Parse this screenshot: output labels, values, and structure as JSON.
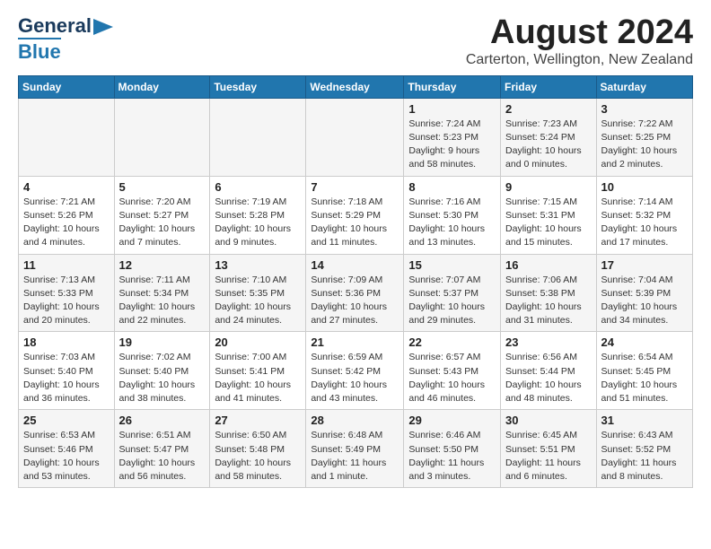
{
  "header": {
    "logo_line1": "General",
    "logo_line2": "Blue",
    "title": "August 2024",
    "subtitle": "Carterton, Wellington, New Zealand"
  },
  "calendar": {
    "days_of_week": [
      "Sunday",
      "Monday",
      "Tuesday",
      "Wednesday",
      "Thursday",
      "Friday",
      "Saturday"
    ],
    "weeks": [
      [
        {
          "day": "",
          "info": ""
        },
        {
          "day": "",
          "info": ""
        },
        {
          "day": "",
          "info": ""
        },
        {
          "day": "",
          "info": ""
        },
        {
          "day": "1",
          "info": "Sunrise: 7:24 AM\nSunset: 5:23 PM\nDaylight: 9 hours\nand 58 minutes."
        },
        {
          "day": "2",
          "info": "Sunrise: 7:23 AM\nSunset: 5:24 PM\nDaylight: 10 hours\nand 0 minutes."
        },
        {
          "day": "3",
          "info": "Sunrise: 7:22 AM\nSunset: 5:25 PM\nDaylight: 10 hours\nand 2 minutes."
        }
      ],
      [
        {
          "day": "4",
          "info": "Sunrise: 7:21 AM\nSunset: 5:26 PM\nDaylight: 10 hours\nand 4 minutes."
        },
        {
          "day": "5",
          "info": "Sunrise: 7:20 AM\nSunset: 5:27 PM\nDaylight: 10 hours\nand 7 minutes."
        },
        {
          "day": "6",
          "info": "Sunrise: 7:19 AM\nSunset: 5:28 PM\nDaylight: 10 hours\nand 9 minutes."
        },
        {
          "day": "7",
          "info": "Sunrise: 7:18 AM\nSunset: 5:29 PM\nDaylight: 10 hours\nand 11 minutes."
        },
        {
          "day": "8",
          "info": "Sunrise: 7:16 AM\nSunset: 5:30 PM\nDaylight: 10 hours\nand 13 minutes."
        },
        {
          "day": "9",
          "info": "Sunrise: 7:15 AM\nSunset: 5:31 PM\nDaylight: 10 hours\nand 15 minutes."
        },
        {
          "day": "10",
          "info": "Sunrise: 7:14 AM\nSunset: 5:32 PM\nDaylight: 10 hours\nand 17 minutes."
        }
      ],
      [
        {
          "day": "11",
          "info": "Sunrise: 7:13 AM\nSunset: 5:33 PM\nDaylight: 10 hours\nand 20 minutes."
        },
        {
          "day": "12",
          "info": "Sunrise: 7:11 AM\nSunset: 5:34 PM\nDaylight: 10 hours\nand 22 minutes."
        },
        {
          "day": "13",
          "info": "Sunrise: 7:10 AM\nSunset: 5:35 PM\nDaylight: 10 hours\nand 24 minutes."
        },
        {
          "day": "14",
          "info": "Sunrise: 7:09 AM\nSunset: 5:36 PM\nDaylight: 10 hours\nand 27 minutes."
        },
        {
          "day": "15",
          "info": "Sunrise: 7:07 AM\nSunset: 5:37 PM\nDaylight: 10 hours\nand 29 minutes."
        },
        {
          "day": "16",
          "info": "Sunrise: 7:06 AM\nSunset: 5:38 PM\nDaylight: 10 hours\nand 31 minutes."
        },
        {
          "day": "17",
          "info": "Sunrise: 7:04 AM\nSunset: 5:39 PM\nDaylight: 10 hours\nand 34 minutes."
        }
      ],
      [
        {
          "day": "18",
          "info": "Sunrise: 7:03 AM\nSunset: 5:40 PM\nDaylight: 10 hours\nand 36 minutes."
        },
        {
          "day": "19",
          "info": "Sunrise: 7:02 AM\nSunset: 5:40 PM\nDaylight: 10 hours\nand 38 minutes."
        },
        {
          "day": "20",
          "info": "Sunrise: 7:00 AM\nSunset: 5:41 PM\nDaylight: 10 hours\nand 41 minutes."
        },
        {
          "day": "21",
          "info": "Sunrise: 6:59 AM\nSunset: 5:42 PM\nDaylight: 10 hours\nand 43 minutes."
        },
        {
          "day": "22",
          "info": "Sunrise: 6:57 AM\nSunset: 5:43 PM\nDaylight: 10 hours\nand 46 minutes."
        },
        {
          "day": "23",
          "info": "Sunrise: 6:56 AM\nSunset: 5:44 PM\nDaylight: 10 hours\nand 48 minutes."
        },
        {
          "day": "24",
          "info": "Sunrise: 6:54 AM\nSunset: 5:45 PM\nDaylight: 10 hours\nand 51 minutes."
        }
      ],
      [
        {
          "day": "25",
          "info": "Sunrise: 6:53 AM\nSunset: 5:46 PM\nDaylight: 10 hours\nand 53 minutes."
        },
        {
          "day": "26",
          "info": "Sunrise: 6:51 AM\nSunset: 5:47 PM\nDaylight: 10 hours\nand 56 minutes."
        },
        {
          "day": "27",
          "info": "Sunrise: 6:50 AM\nSunset: 5:48 PM\nDaylight: 10 hours\nand 58 minutes."
        },
        {
          "day": "28",
          "info": "Sunrise: 6:48 AM\nSunset: 5:49 PM\nDaylight: 11 hours\nand 1 minute."
        },
        {
          "day": "29",
          "info": "Sunrise: 6:46 AM\nSunset: 5:50 PM\nDaylight: 11 hours\nand 3 minutes."
        },
        {
          "day": "30",
          "info": "Sunrise: 6:45 AM\nSunset: 5:51 PM\nDaylight: 11 hours\nand 6 minutes."
        },
        {
          "day": "31",
          "info": "Sunrise: 6:43 AM\nSunset: 5:52 PM\nDaylight: 11 hours\nand 8 minutes."
        }
      ]
    ]
  }
}
